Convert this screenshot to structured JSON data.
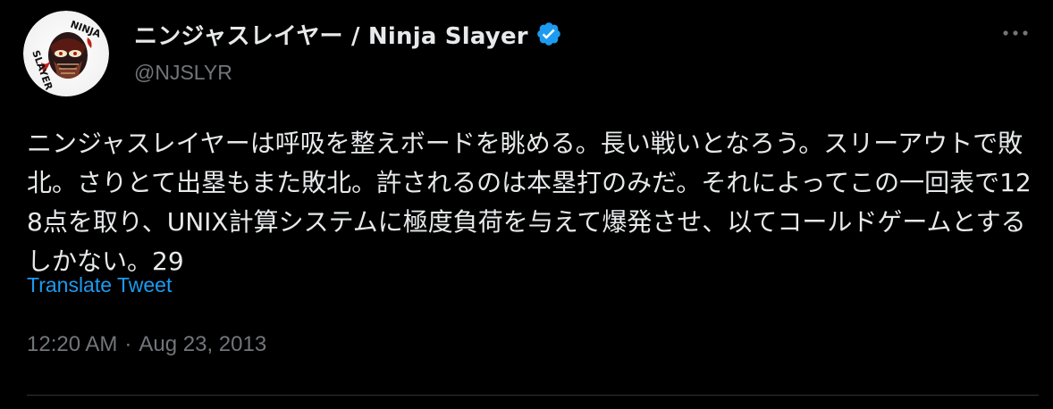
{
  "author": {
    "display_name": "ニンジャスレイヤー / Ninja Slayer",
    "handle": "@NJSLYR",
    "verified": true,
    "avatar_text": "NINJA SLAYER"
  },
  "tweet": {
    "text": "ニンジャスレイヤーは呼吸を整えボードを眺める。長い戦いとなろう。スリーアウトで敗北。さりとて出塁もまた敗北。許されるのは本塁打のみだ。それによってこの一回表で128点を取り、UNIX計算システムに極度負荷を与えて爆発させ、以てコールドゲームとするしかない。29",
    "translate_label": "Translate Tweet",
    "time": "12:20 AM",
    "separator": "·",
    "date": "Aug 23, 2013"
  },
  "colors": {
    "background": "#000000",
    "text": "#e7e9ea",
    "secondary": "#71767b",
    "link": "#1d9bf0",
    "verified": "#1d9bf0",
    "divider": "#2f3336"
  },
  "icons": {
    "more": "more-horizontal-icon",
    "verified": "verified-badge-icon"
  }
}
